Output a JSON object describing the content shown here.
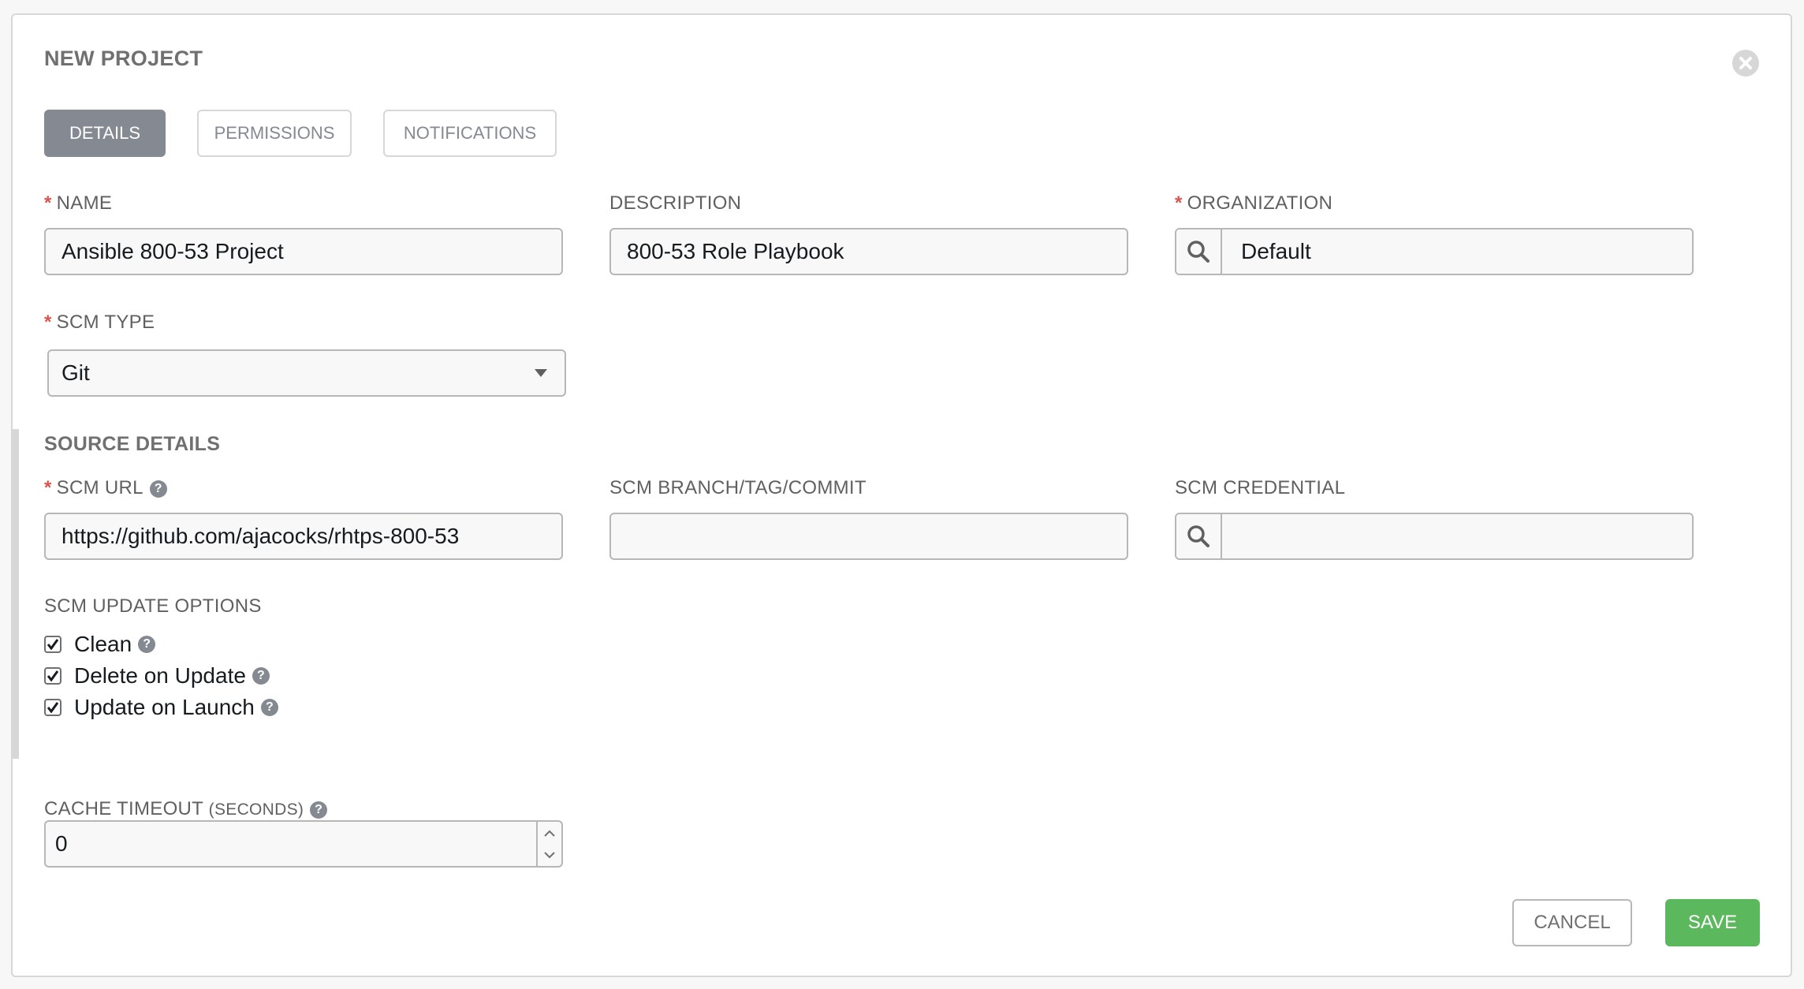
{
  "header": {
    "title": "NEW PROJECT"
  },
  "tabs": [
    {
      "label": "DETAILS",
      "active": true
    },
    {
      "label": "PERMISSIONS",
      "active": false
    },
    {
      "label": "NOTIFICATIONS",
      "active": false
    }
  ],
  "fields": {
    "name": {
      "label": "NAME",
      "required": true,
      "value": "Ansible 800-53 Project"
    },
    "description": {
      "label": "DESCRIPTION",
      "required": false,
      "value": "800-53 Role Playbook"
    },
    "organization": {
      "label": "ORGANIZATION",
      "required": true,
      "value": "Default"
    },
    "scm_type": {
      "label": "SCM TYPE",
      "required": true,
      "value": "Git"
    }
  },
  "source_details": {
    "title": "SOURCE DETAILS",
    "scm_url": {
      "label": "SCM URL",
      "required": true,
      "value": "https://github.com/ajacocks/rhtps-800-53"
    },
    "scm_branch": {
      "label": "SCM BRANCH/TAG/COMMIT",
      "value": ""
    },
    "scm_credential": {
      "label": "SCM CREDENTIAL",
      "value": ""
    },
    "update_options": {
      "label": "SCM UPDATE OPTIONS",
      "options": [
        {
          "label": "Clean",
          "checked": true
        },
        {
          "label": "Delete on Update",
          "checked": true
        },
        {
          "label": "Update on Launch",
          "checked": true
        }
      ]
    }
  },
  "cache_timeout": {
    "label": "CACHE TIMEOUT",
    "label_suffix": "(SECONDS)",
    "value": "0"
  },
  "actions": {
    "cancel_label": "CANCEL",
    "save_label": "SAVE"
  },
  "colors": {
    "required_asterisk": "#d9534f",
    "active_tab": "#848992",
    "save_button": "#5cb85c"
  },
  "icons": {
    "close": "close-circle-icon",
    "lookup": "search-icon",
    "help": "question-circle-icon",
    "select": "caret-down-icon",
    "check": "checkmark-icon"
  }
}
